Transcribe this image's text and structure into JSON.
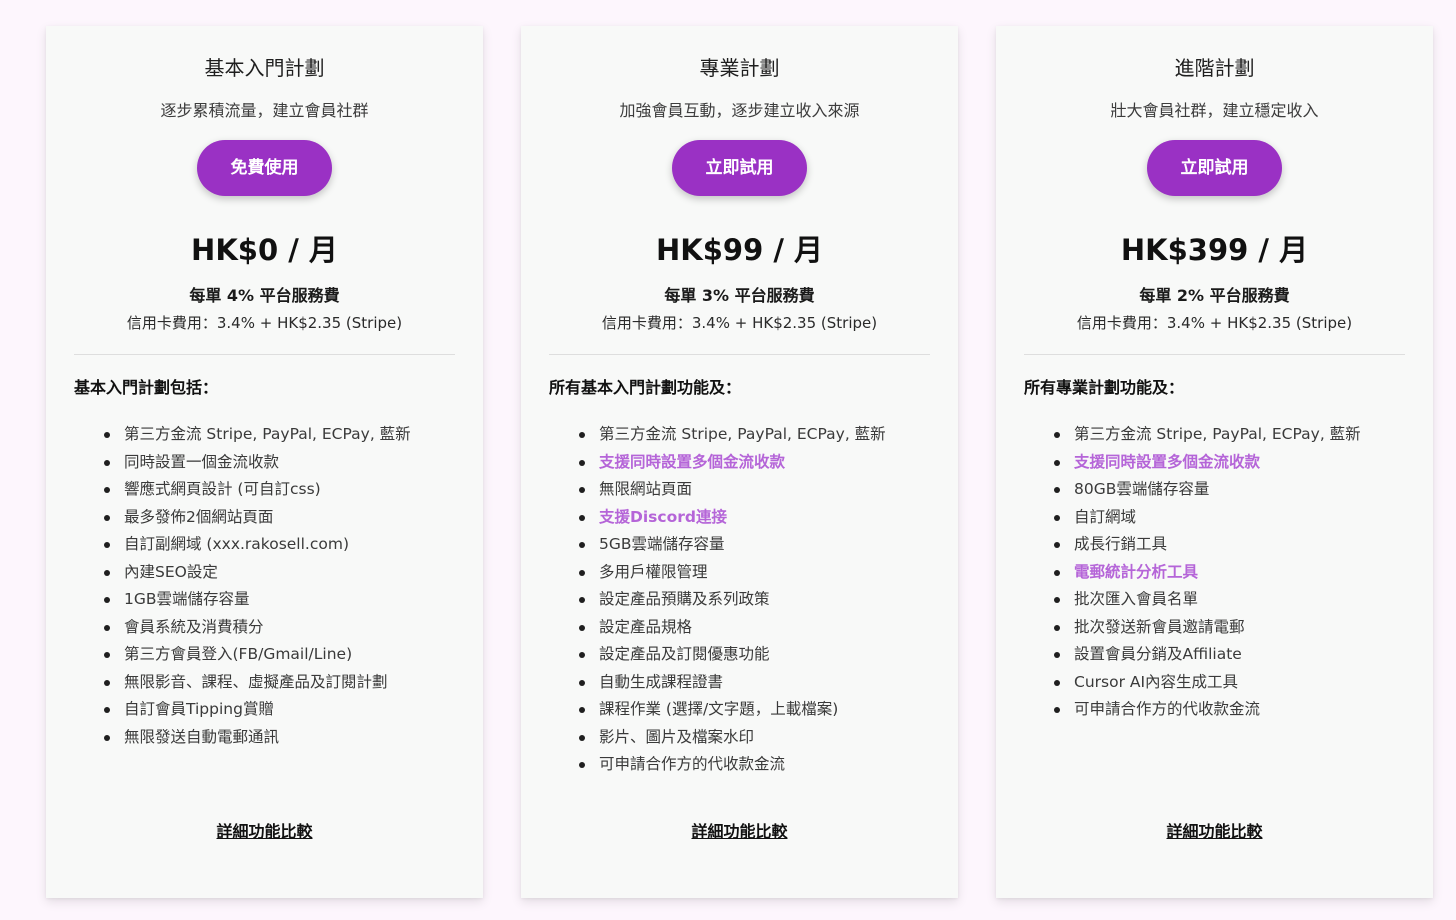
{
  "colors": {
    "page_background": "#fdf6fd",
    "card_background": "#f8f9f8",
    "accent_button": "#9a31c4",
    "highlight_text": "#b565d8"
  },
  "plans": [
    {
      "name": "基本入門計劃",
      "subtitle": "逐步累積流量，建立會員社群",
      "cta_label": "免費使用",
      "price": "HK$0 / 月",
      "service_fee": "每單 4% 平台服務費",
      "card_fee": "信用卡費用：3.4% + HK$2.35 (Stripe)",
      "features_heading": "基本入門計劃包括：",
      "features": [
        {
          "text": "第三方金流 Stripe, PayPal, ECPay, 藍新",
          "highlight": false
        },
        {
          "text": "同時設置一個金流收款",
          "highlight": false
        },
        {
          "text": "響應式網頁設計 (可自訂css)",
          "highlight": false
        },
        {
          "text": "最多發佈2個網站頁面",
          "highlight": false
        },
        {
          "text": "自訂副網域 (xxx.rakosell.com)",
          "highlight": false
        },
        {
          "text": "內建SEO設定",
          "highlight": false
        },
        {
          "text": "1GB雲端儲存容量",
          "highlight": false
        },
        {
          "text": "會員系統及消費積分",
          "highlight": false
        },
        {
          "text": "第三方會員登入(FB/Gmail/Line)",
          "highlight": false
        },
        {
          "text": "無限影音、課程、虛擬產品及訂閱計劃",
          "highlight": false
        },
        {
          "text": "自訂會員Tipping賞贈",
          "highlight": false
        },
        {
          "text": "無限發送自動電郵通訊",
          "highlight": false
        }
      ],
      "compare_link": "詳細功能比較"
    },
    {
      "name": "專業計劃",
      "subtitle": "加強會員互動，逐步建立收入來源",
      "cta_label": "立即試用",
      "price": "HK$99 / 月",
      "service_fee": "每單 3% 平台服務費",
      "card_fee": "信用卡費用：3.4% + HK$2.35 (Stripe)",
      "features_heading": "所有基本入門計劃功能及：",
      "features": [
        {
          "text": "第三方金流 Stripe, PayPal, ECPay, 藍新",
          "highlight": false
        },
        {
          "text": "支援同時設置多個金流收款",
          "highlight": true
        },
        {
          "text": "無限網站頁面",
          "highlight": false
        },
        {
          "text": "支援Discord連接",
          "highlight": true
        },
        {
          "text": "5GB雲端儲存容量",
          "highlight": false
        },
        {
          "text": "多用戶權限管理",
          "highlight": false
        },
        {
          "text": "設定產品預購及系列政策",
          "highlight": false
        },
        {
          "text": "設定產品規格",
          "highlight": false
        },
        {
          "text": "設定產品及訂閱優惠功能",
          "highlight": false
        },
        {
          "text": "自動生成課程證書",
          "highlight": false
        },
        {
          "text": "課程作業 (選擇/文字題，上載檔案)",
          "highlight": false
        },
        {
          "text": "影片、圖片及檔案水印",
          "highlight": false
        },
        {
          "text": "可申請合作方的代收款金流",
          "highlight": false
        }
      ],
      "compare_link": "詳細功能比較"
    },
    {
      "name": "進階計劃",
      "subtitle": "壯大會員社群，建立穩定收入",
      "cta_label": "立即試用",
      "price": "HK$399 / 月",
      "service_fee": "每單 2% 平台服務費",
      "card_fee": "信用卡費用：3.4% + HK$2.35 (Stripe)",
      "features_heading": "所有專業計劃功能及：",
      "features": [
        {
          "text": "第三方金流 Stripe, PayPal, ECPay, 藍新",
          "highlight": false
        },
        {
          "text": "支援同時設置多個金流收款",
          "highlight": true
        },
        {
          "text": "80GB雲端儲存容量",
          "highlight": false
        },
        {
          "text": "自訂網域",
          "highlight": false
        },
        {
          "text": "成長行銷工具",
          "highlight": false
        },
        {
          "text": "電郵統計分析工具",
          "highlight": true
        },
        {
          "text": "批次匯入會員名單",
          "highlight": false
        },
        {
          "text": "批次發送新會員邀請電郵",
          "highlight": false
        },
        {
          "text": "設置會員分銷及Affiliate",
          "highlight": false
        },
        {
          "text": "Cursor AI內容生成工具",
          "highlight": false
        },
        {
          "text": "可申請合作方的代收款金流",
          "highlight": false
        }
      ],
      "compare_link": "詳細功能比較"
    }
  ]
}
